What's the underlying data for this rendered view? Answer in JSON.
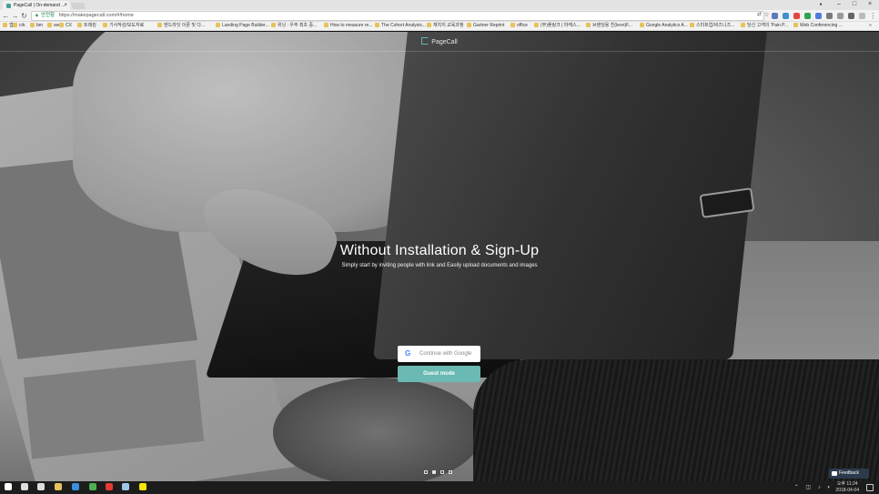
{
  "browser": {
    "tab_title": "PageCall | On-demand ...",
    "tab_close": "×",
    "window_controls": [
      "–",
      "□",
      "×"
    ],
    "secure_label": "안전함",
    "url": "https://makepagecall.com/#/home",
    "bookmarks": [
      {
        "label": "앱"
      },
      {
        "label": "crk"
      },
      {
        "label": "bm"
      },
      {
        "label": "seo"
      },
      {
        "label": "CX"
      },
      {
        "label": "트래킹"
      },
      {
        "label": "기사작성/보도자료"
      },
      {
        "label": "엔드라잇 이론 및 다..."
      },
      {
        "label": "Landing Page Builder..."
      },
      {
        "label": "위닝 : 우주 최초 중..."
      },
      {
        "label": "How to measure re..."
      },
      {
        "label": "The Cohort Analysis..."
      },
      {
        "label": "재치지 교육과정"
      },
      {
        "label": "Gartner Reprint"
      },
      {
        "label": "office"
      },
      {
        "label": "(주)플링크 | 마케스..."
      },
      {
        "label": "브랜딩용 친(leon)F..."
      },
      {
        "label": "Google Analytics A..."
      },
      {
        "label": "스타트업/비즈니즈..."
      },
      {
        "label": "당신 고객의 'Pain P..."
      },
      {
        "label": "Web Conferencing ..."
      }
    ]
  },
  "page": {
    "brand_name": "PageCall",
    "headline": "Without Installation & Sign-Up",
    "subline": "Simply start by inviting people with link and Easily upload documents and images",
    "google_button_label": "Continue with Google",
    "google_glyph": "G",
    "guest_button_label": "Guest mode",
    "carousel_active_index": 1,
    "carousel_count": 4,
    "feedback_label": "Feedback"
  },
  "taskbar": {
    "time": "오후 11:24",
    "date": "2018-04-04",
    "apps": [
      {
        "name": "windows-start-icon",
        "color": "#ffffff"
      },
      {
        "name": "search-icon",
        "color": "#dddddd"
      },
      {
        "name": "task-view-icon",
        "color": "#dddddd"
      },
      {
        "name": "file-explorer-icon",
        "color": "#e8c25c"
      },
      {
        "name": "edge-icon",
        "color": "#3b8ed8"
      },
      {
        "name": "chrome-icon",
        "color": "#4caf50"
      },
      {
        "name": "opera-icon",
        "color": "#e53935"
      },
      {
        "name": "app-icon",
        "color": "#9ec5e8"
      },
      {
        "name": "kakaotalk-icon",
        "color": "#f7e600"
      }
    ]
  },
  "colors": {
    "accent": "#6ab9b3",
    "feedback_bg": "#2c3b4c"
  }
}
